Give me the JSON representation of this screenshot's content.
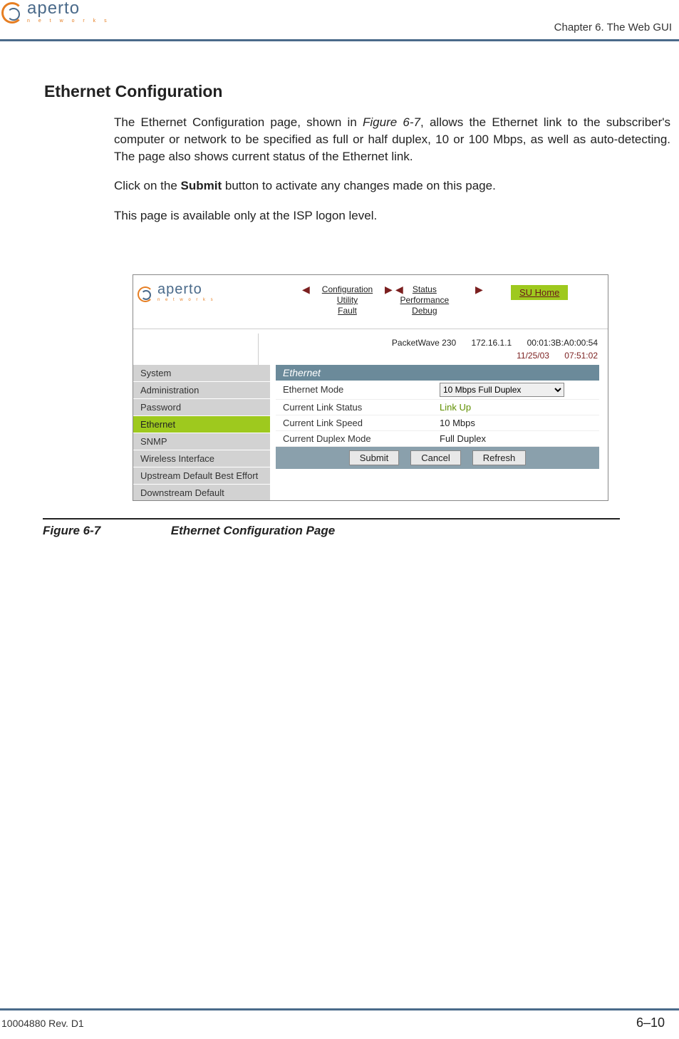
{
  "header": {
    "chapter_text": "Chapter 6.  The Web GUI",
    "logo_main": "aperto",
    "logo_sub": "n e t w o r k s"
  },
  "section": {
    "title": "Ethernet Configuration",
    "para1_a": "The Ethernet Configuration page, shown in ",
    "para1_ref": "Figure 6-7",
    "para1_b": ", allows the Ethernet link to the subscriber's computer or network to be specified as full or half duplex, 10 or 100 Mbps, as well as auto-detecting. The page also shows current status of the Ethernet link.",
    "para2_a": "Click on the ",
    "para2_bold": "Submit",
    "para2_b": " button to activate any changes made on this page.",
    "para3": "This page is available only at the ISP logon level."
  },
  "figure": {
    "logo_main": "aperto",
    "logo_sub": "n e t w o r k s",
    "tabs1": [
      "Configuration",
      "Utility",
      "Fault"
    ],
    "tabs2": [
      "Status",
      "Performance",
      "Debug"
    ],
    "su_home": "SU Home",
    "device": {
      "model": "PacketWave 230",
      "ip": "172.16.1.1",
      "mac": "00:01:3B:A0:00:54",
      "date": "11/25/03",
      "time": "07:51:02"
    },
    "menu": [
      "System",
      "Administration",
      "Password",
      "Ethernet",
      "SNMP",
      "Wireless Interface",
      "Upstream Default Best Effort",
      "Downstream Default"
    ],
    "menu_active_index": 3,
    "panel": {
      "title": "Ethernet",
      "rows": [
        {
          "label": "Ethernet Mode",
          "type": "select",
          "value": "10 Mbps Full Duplex"
        },
        {
          "label": "Current Link Status",
          "type": "green",
          "value": "Link Up"
        },
        {
          "label": "Current Link Speed",
          "type": "text",
          "value": "10 Mbps"
        },
        {
          "label": "Current Duplex Mode",
          "type": "text",
          "value": "Full Duplex"
        }
      ]
    },
    "buttons": [
      "Submit",
      "Cancel",
      "Refresh"
    ]
  },
  "caption": {
    "num": "Figure 6-7",
    "title": "Ethernet Configuration Page"
  },
  "footer": {
    "left": "10004880 Rev. D1",
    "right": "6–10"
  }
}
